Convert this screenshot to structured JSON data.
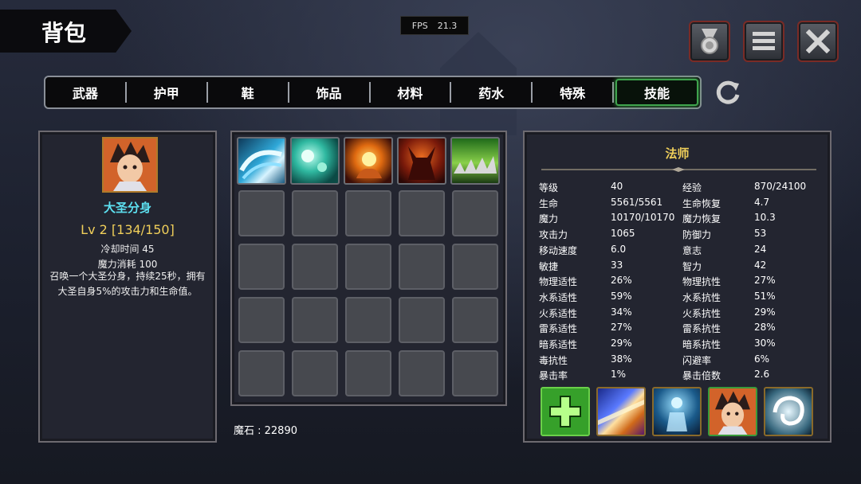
{
  "header": {
    "title": "背包",
    "fps_label": "FPS",
    "fps_value": "21.3"
  },
  "top_buttons": {
    "medal": "medal-icon",
    "menu": "menu-icon",
    "close": "close-icon"
  },
  "tabs": [
    {
      "label": "武器"
    },
    {
      "label": "护甲"
    },
    {
      "label": "鞋"
    },
    {
      "label": "饰品"
    },
    {
      "label": "材料"
    },
    {
      "label": "药水"
    },
    {
      "label": "特殊"
    },
    {
      "label": "技能",
      "active": true
    }
  ],
  "skill_detail": {
    "name": "大圣分身",
    "level": "Lv 2 [134/150]",
    "cooldown": "冷却时间 45",
    "mana_cost": "魔力消耗 100",
    "desc_line1": "召唤一个大圣分身，持续25秒，拥有",
    "desc_line2": "大圣自身5%的攻击力和生命值。"
  },
  "inventory": {
    "skills": [
      "water-wave",
      "teal-burst",
      "fire-palm",
      "demon-shadow",
      "green-spikes"
    ],
    "empty_slots": 20
  },
  "magic_stone": "魔石 : 22890",
  "stats": {
    "class": "法师",
    "left": [
      {
        "k": "等级",
        "v": "40"
      },
      {
        "k": "生命",
        "v": "5561/5561"
      },
      {
        "k": "魔力",
        "v": "10170/10170"
      },
      {
        "k": "攻击力",
        "v": "1065"
      },
      {
        "k": "移动速度",
        "v": "6.0"
      },
      {
        "k": "敏捷",
        "v": "33"
      },
      {
        "k": "物理适性",
        "v": "26%"
      },
      {
        "k": "水系适性",
        "v": "59%"
      },
      {
        "k": "火系适性",
        "v": "34%"
      },
      {
        "k": "雷系适性",
        "v": "27%"
      },
      {
        "k": "暗系适性",
        "v": "29%"
      },
      {
        "k": "毒抗性",
        "v": "38%"
      },
      {
        "k": "暴击率",
        "v": "1%"
      }
    ],
    "right": [
      {
        "k": "经验",
        "v": "870/24100"
      },
      {
        "k": "生命恢复",
        "v": "4.7"
      },
      {
        "k": "魔力恢复",
        "v": "10.3"
      },
      {
        "k": "防御力",
        "v": "53"
      },
      {
        "k": "意志",
        "v": "24"
      },
      {
        "k": "智力",
        "v": "42"
      },
      {
        "k": "物理抗性",
        "v": "27%"
      },
      {
        "k": "水系抗性",
        "v": "51%"
      },
      {
        "k": "火系抗性",
        "v": "29%"
      },
      {
        "k": "雷系抗性",
        "v": "28%"
      },
      {
        "k": "暗系抗性",
        "v": "30%"
      },
      {
        "k": "闪避率",
        "v": "6%"
      },
      {
        "k": "暴击倍数",
        "v": "2.6"
      }
    ]
  },
  "equipped_skills": [
    "heal-plus",
    "light-beam",
    "spirit-body",
    "clone-portrait",
    "whirlwind"
  ]
}
